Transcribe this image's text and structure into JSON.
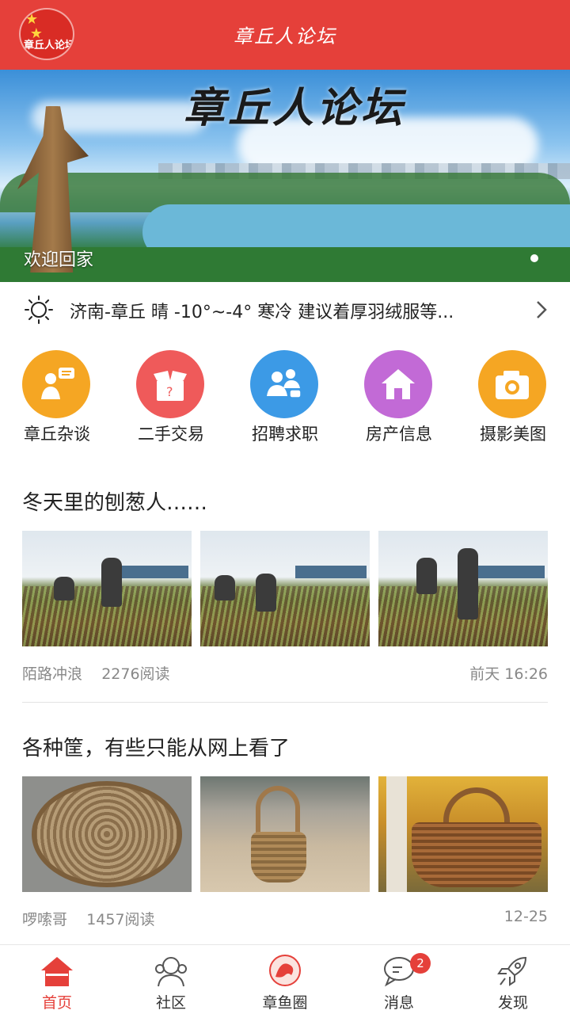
{
  "header": {
    "title": "章丘人论坛",
    "logo_text": "章丘人论坛"
  },
  "banner": {
    "title": "章丘人论坛",
    "caption": "欢迎回家",
    "slide_count": 2,
    "active_slide": 2
  },
  "weather": {
    "icon": "sun-icon",
    "text": "济南-章丘 晴 -10°~-4° 寒冷 建议着厚羽绒服等..."
  },
  "categories": [
    {
      "label": "章丘杂谈",
      "icon": "chat-person-icon",
      "color": "#f5a623"
    },
    {
      "label": "二手交易",
      "icon": "box-icon",
      "color": "#ef5a5a"
    },
    {
      "label": "招聘求职",
      "icon": "people-icon",
      "color": "#3c9ae6"
    },
    {
      "label": "房产信息",
      "icon": "house-icon",
      "color": "#c26ad6"
    },
    {
      "label": "摄影美图",
      "icon": "camera-icon",
      "color": "#f5a623"
    }
  ],
  "posts": [
    {
      "title": "冬天里的刨葱人……",
      "author": "陌路冲浪",
      "reads": "2276阅读",
      "time": "前天 16:26"
    },
    {
      "title": "各种筐，有些只能从网上看了",
      "author": "啰嗦哥",
      "reads": "1457阅读",
      "time": "12-25"
    }
  ],
  "nav": [
    {
      "label": "首页",
      "icon": "home-icon",
      "active": true
    },
    {
      "label": "社区",
      "icon": "community-icon"
    },
    {
      "label": "章鱼圈",
      "icon": "octopus-icon"
    },
    {
      "label": "消息",
      "icon": "message-icon",
      "badge": "2"
    },
    {
      "label": "发现",
      "icon": "rocket-icon"
    }
  ],
  "colors": {
    "accent": "#e5403a"
  }
}
